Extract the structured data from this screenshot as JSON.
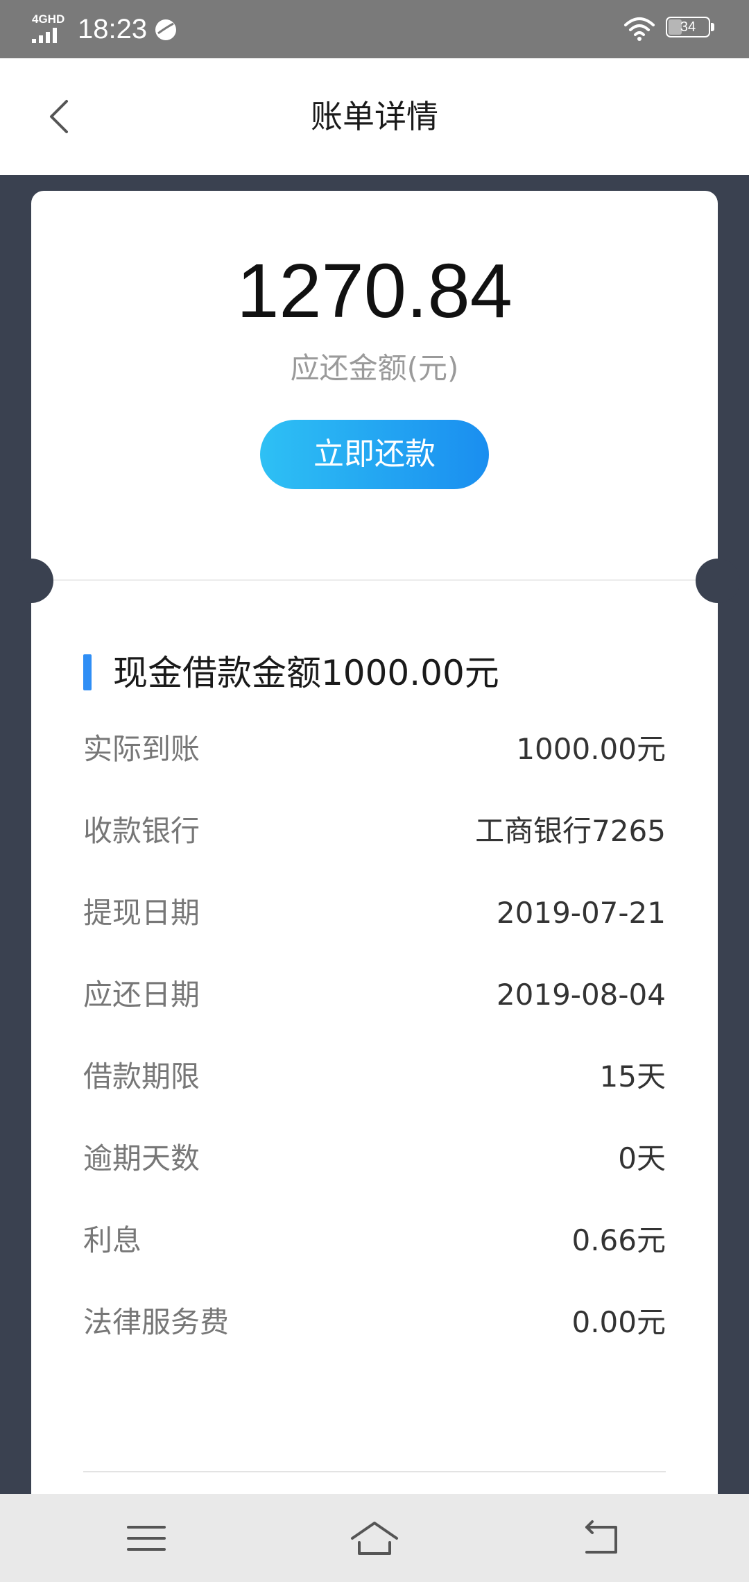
{
  "status_bar": {
    "network": "4GHD",
    "time": "18:23",
    "battery": "34",
    "battery_fraction": 0.34,
    "icons": [
      "signal-icon",
      "moon-icon",
      "wifi-icon",
      "battery-icon"
    ]
  },
  "header": {
    "title": "账单详情",
    "back_icon": "chevron-left-icon"
  },
  "summary": {
    "amount": "1270.84",
    "amount_label": "应还金额(元)",
    "repay_label": "立即还款",
    "button_colors": [
      "#2ec0f4",
      "#1a8ef0"
    ]
  },
  "section": {
    "title": "现金借款金额1000.00元",
    "accent_color": "#2f8ef5"
  },
  "details": [
    {
      "label": "实际到账",
      "value": "1000.00元"
    },
    {
      "label": "收款银行",
      "value": "工商银行7265"
    },
    {
      "label": "提现日期",
      "value": "2019-07-21"
    },
    {
      "label": "应还日期",
      "value": "2019-08-04"
    },
    {
      "label": "借款期限",
      "value": "15天"
    },
    {
      "label": "逾期天数",
      "value": "0天"
    },
    {
      "label": "利息",
      "value": "0.66元"
    },
    {
      "label": "法律服务费",
      "value": "0.00元"
    }
  ],
  "nav": {
    "icons": [
      "menu-icon",
      "home-icon",
      "back-icon"
    ]
  }
}
